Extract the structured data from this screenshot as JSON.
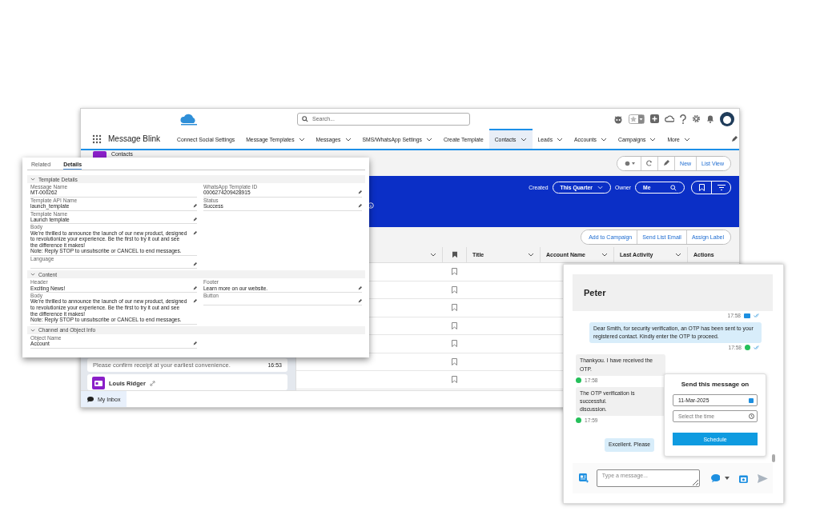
{
  "app": {
    "name": "Message Blink",
    "search": {
      "placeholder": "Search..."
    },
    "nav": [
      {
        "label": "Connect Social Settings",
        "dropdown": false,
        "selected": false
      },
      {
        "label": "Message Templates",
        "dropdown": true,
        "selected": false
      },
      {
        "label": "Messages",
        "dropdown": true,
        "selected": false
      },
      {
        "label": "SMS/WhatsApp Settings",
        "dropdown": true,
        "selected": false
      },
      {
        "label": "Create Template",
        "dropdown": false,
        "selected": false
      },
      {
        "label": "Contacts",
        "dropdown": true,
        "selected": true
      },
      {
        "label": "Leads",
        "dropdown": true,
        "selected": false
      },
      {
        "label": "Accounts",
        "dropdown": true,
        "selected": false
      },
      {
        "label": "Campaigns",
        "dropdown": true,
        "selected": false
      },
      {
        "label": "More",
        "dropdown": true,
        "selected": false
      }
    ],
    "object": "Contacts",
    "header_buttons": [
      {
        "kind": "gear"
      },
      {
        "kind": "refresh"
      },
      {
        "kind": "edit"
      },
      {
        "kind": "text",
        "label": "New"
      },
      {
        "kind": "text",
        "label": "List View"
      }
    ],
    "filters": {
      "created_label": "Created",
      "created_value": "This Quarter",
      "owner_label": "Owner",
      "owner_value": "Me"
    },
    "actions": [
      "Add to Campaign",
      "Send List Email",
      "Assign Label"
    ],
    "columns": [
      {
        "kind": "blank",
        "menu": true
      },
      {
        "kind": "bookmark",
        "menu": false
      },
      {
        "kind": "text",
        "label": "Title",
        "menu": true
      },
      {
        "kind": "text",
        "label": "Account Name",
        "menu": true
      },
      {
        "kind": "text",
        "label": "Last Activity",
        "menu": true
      },
      {
        "kind": "text",
        "label": "Actions",
        "menu": false
      }
    ],
    "rows": [
      {
        "bookmarked": false
      },
      {
        "bookmarked": false
      },
      {
        "bookmarked": false
      },
      {
        "bookmarked": false
      },
      {
        "bookmarked": false
      },
      {
        "bookmarked": false
      },
      {
        "bookmarked": false
      }
    ],
    "inbox": [
      {
        "kind": "message",
        "text": "Please confirm receipt at your earliest convenience.",
        "time": "16:53"
      },
      {
        "kind": "contact",
        "name": "Louis Ridger"
      }
    ],
    "footer": "My Inbox"
  },
  "details": {
    "tabs": [
      {
        "label": "Related",
        "selected": false
      },
      {
        "label": "Details",
        "selected": true
      }
    ],
    "sections": [
      {
        "title": "Template Details",
        "expanded": true,
        "left": [
          {
            "label": "Message Name",
            "value": "MT-000262",
            "editable": false
          },
          {
            "label": "Template API Name",
            "value": "launch_template",
            "editable": true
          },
          {
            "label": "Template Name",
            "value": "Launch template",
            "editable": true
          },
          {
            "label": "Body",
            "value": "We're thrilled to announce the launch of our new product, designed to revolutionize your experience. Be the first to try it out and see the difference it makes!\nNote: Reply STOP to unsubscribe or CANCEL to end messages.",
            "editable": true
          },
          {
            "label": "Language",
            "editable": true
          }
        ],
        "right": [
          {
            "label": "WhatsApp Template ID",
            "value": "0006274209428915",
            "editable": true
          },
          {
            "label": "Status",
            "value": "Success",
            "editable": true
          }
        ]
      },
      {
        "title": "Content",
        "expanded": true,
        "left": [
          {
            "label": "Header",
            "value": "Exciting News!",
            "editable": true
          },
          {
            "label": "Body",
            "value": "We're thrilled to announce the launch of our new product, designed to revolutionize your experience. Be the first to try it out and see the difference it makes!\nNote: Reply STOP to unsubscribe or CANCEL to end messages.",
            "editable": true
          }
        ],
        "right": [
          {
            "label": "Footer",
            "value": "Learn more on our website.",
            "editable": true
          },
          {
            "label": "Button",
            "editable": true
          }
        ]
      },
      {
        "title": "Channel and Object Info",
        "expanded": true,
        "left": [
          {
            "label": "Object Name",
            "value": "Account",
            "editable": true
          }
        ]
      }
    ]
  },
  "chat": {
    "contact": "Peter",
    "messages": [
      {
        "kind": "outgoing",
        "whatsapp": false,
        "time": "17:58"
      },
      {
        "kind": "outgoing",
        "whatsapp": true,
        "text": "Dear Smith, for security verification, an OTP has been sent to your registered contact. Kindly enter the OTP to proceed.",
        "time": "17:58"
      },
      {
        "kind": "incoming",
        "whatsapp": true,
        "text": "Thankyou. I have received the OTP.",
        "time": "17:58"
      },
      {
        "kind": "incoming",
        "whatsapp": true,
        "text": "The OTP verification is successful.\ndiscussion.",
        "time": "17:59"
      },
      {
        "kind": "outgoing",
        "text": "Excellent. Please"
      }
    ],
    "schedule": {
      "title": "Send this message on",
      "date": "11-Mar-2025",
      "time_placeholder": "Select the time",
      "button": "Schedule"
    },
    "composer": {
      "placeholder": "Type a message..."
    }
  }
}
